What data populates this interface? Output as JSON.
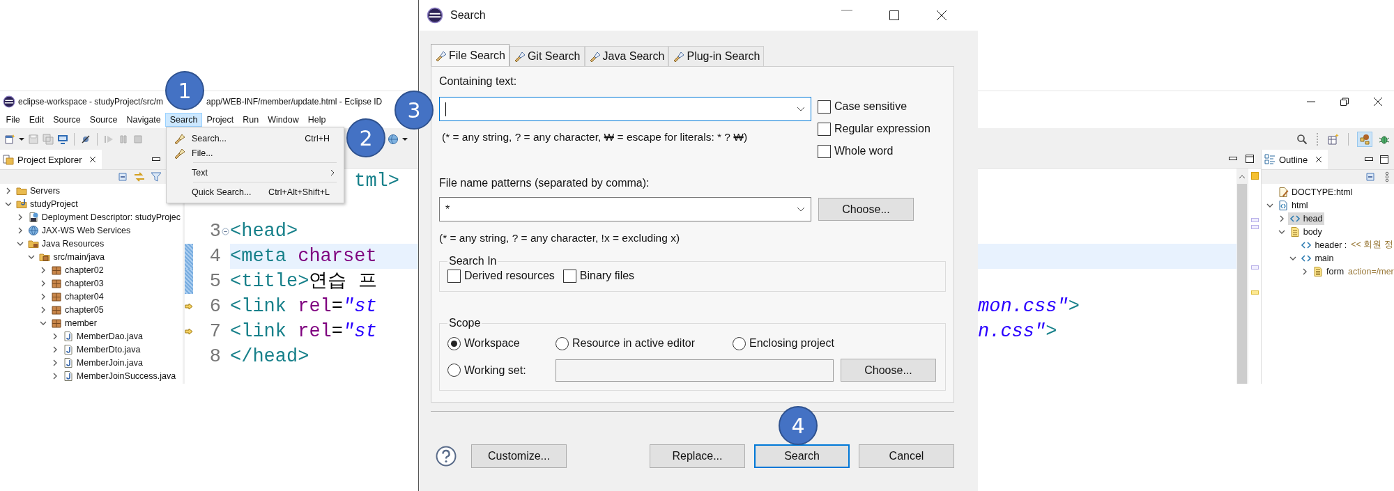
{
  "eclipse": {
    "title_start": "eclipse-workspace - studyProject/src/m",
    "title_end": "app/WEB-INF/member/update.html - Eclipse ID",
    "menu": [
      {
        "label": "File",
        "selected": false
      },
      {
        "label": "Edit",
        "selected": false
      },
      {
        "label": "Source",
        "selected": false
      },
      {
        "label": "Source",
        "selected": false
      },
      {
        "label": "Navigate",
        "selected": false
      },
      {
        "label": "Search",
        "selected": true
      },
      {
        "label": "Project",
        "selected": false
      },
      {
        "label": "Run",
        "selected": false
      },
      {
        "label": "Window",
        "selected": false
      },
      {
        "label": "Help",
        "selected": false
      }
    ],
    "menu_popup": [
      {
        "kind": "item",
        "label": "Search...",
        "shortcut": "Ctrl+H",
        "icon": true
      },
      {
        "kind": "item",
        "label": "File...",
        "icon": true
      },
      {
        "kind": "separator"
      },
      {
        "kind": "submenu",
        "label": "Text",
        "icon": false
      },
      {
        "kind": "separator"
      },
      {
        "kind": "item",
        "label": "Quick Search...",
        "shortcut": "Ctrl+Alt+Shift+L",
        "icon": false
      }
    ],
    "project_explorer": {
      "title": "Project Explorer",
      "tree": [
        {
          "label": "Servers",
          "kind": "folder",
          "expanded": false
        },
        {
          "label": "studyProject",
          "kind": "project",
          "expanded": true,
          "children": [
            {
              "label": "Deployment Descriptor: studyProjec",
              "kind": "descriptor",
              "expanded": false
            },
            {
              "label": "JAX-WS Web Services",
              "kind": "webservice",
              "expanded": false
            },
            {
              "label": "Java Resources",
              "kind": "resources",
              "expanded": true,
              "children": [
                {
                  "label": "src/main/java",
                  "kind": "srcfolder",
                  "expanded": true,
                  "children": [
                    {
                      "label": "chapter02",
                      "kind": "package",
                      "expanded": false
                    },
                    {
                      "label": "chapter03",
                      "kind": "package",
                      "expanded": false
                    },
                    {
                      "label": "chapter04",
                      "kind": "package",
                      "expanded": false
                    },
                    {
                      "label": "chapter05",
                      "kind": "package",
                      "expanded": false
                    },
                    {
                      "label": "member",
                      "kind": "package",
                      "expanded": true,
                      "children": [
                        {
                          "label": "MemberDao.java",
                          "kind": "java",
                          "expanded": false
                        },
                        {
                          "label": "MemberDto.java",
                          "kind": "java",
                          "expanded": false
                        },
                        {
                          "label": "MemberJoin.java",
                          "kind": "java",
                          "expanded": false
                        },
                        {
                          "label": "MemberJoinSuccess.java",
                          "kind": "java",
                          "expanded": false
                        }
                      ]
                    }
                  ]
                }
              ]
            }
          ]
        }
      ]
    },
    "editor": {
      "lines": [
        {
          "tokens": [
            {
              "kind": "tag",
              "text": "tml>"
            }
          ],
          "current": false
        },
        {
          "current": false
        },
        {
          "number": "3",
          "tokens": [
            {
              "kind": "tag",
              "text": "<head>"
            }
          ],
          "current": false,
          "fold": true,
          "changed": false,
          "flagged": false
        },
        {
          "number": "4",
          "tokens": [
            {
              "kind": "tag",
              "text": "<meta"
            },
            {
              "kind": "attr",
              "text": " charset"
            }
          ],
          "current": true,
          "fold": false,
          "changed": true,
          "flagged": false
        },
        {
          "number": "5",
          "tokens": [
            {
              "kind": "tag",
              "text": "<title>"
            },
            {
              "kind": "plain",
              "text": "연습 프"
            }
          ],
          "current": false,
          "fold": false,
          "changed": true,
          "flagged": false
        },
        {
          "number": "6",
          "tokens": [
            {
              "kind": "tag",
              "text": "<link"
            },
            {
              "kind": "attr",
              "text": " rel"
            },
            {
              "kind": "plain",
              "text": "="
            },
            {
              "kind": "string",
              "text": "\"st"
            }
          ],
          "tail": [
            {
              "kind": "string",
              "text": "mon.css\""
            },
            {
              "kind": "tag",
              "text": ">"
            }
          ],
          "current": false,
          "fold": false,
          "changed": false,
          "flagged": true
        },
        {
          "number": "7",
          "tokens": [
            {
              "kind": "tag",
              "text": "<link"
            },
            {
              "kind": "attr",
              "text": " rel"
            },
            {
              "kind": "plain",
              "text": "="
            },
            {
              "kind": "string",
              "text": "\"st"
            }
          ],
          "tail": [
            {
              "kind": "string",
              "text": "n.css\""
            },
            {
              "kind": "tag",
              "text": ">"
            }
          ],
          "current": false,
          "fold": false,
          "changed": false,
          "flagged": true
        },
        {
          "number": "8",
          "tokens": [
            {
              "kind": "tag",
              "text": "</head>"
            }
          ],
          "current": false,
          "fold": false,
          "changed": false,
          "flagged": false
        }
      ]
    },
    "outline": {
      "title": "Outline",
      "tree": [
        {
          "label": "DOCTYPE:html",
          "kind": "doctype",
          "selected": false
        },
        {
          "label": "html",
          "kind": "html",
          "expanded": true,
          "selected": false,
          "children": [
            {
              "label": "head",
              "kind": "element",
              "expanded": false,
              "selected": true
            },
            {
              "label": "body",
              "kind": "body",
              "expanded": true,
              "selected": false,
              "children": [
                {
                  "label": "header :",
                  "detail": "<< 회원 정",
                  "kind": "element",
                  "selected": false
                },
                {
                  "label": "main",
                  "kind": "element",
                  "expanded": true,
                  "selected": false,
                  "children": [
                    {
                      "label": "form",
                      "detail": "action=/mer",
                      "kind": "form",
                      "expanded": false,
                      "selected": false
                    }
                  ]
                }
              ]
            }
          ]
        }
      ]
    }
  },
  "dialog": {
    "title": "Search",
    "tabs": [
      {
        "label": "File Search",
        "selected": true
      },
      {
        "label": "Git Search",
        "selected": false
      },
      {
        "label": "Java Search",
        "selected": false
      },
      {
        "label": "Plug-in Search",
        "selected": false
      }
    ],
    "containing_label": "Containing text:",
    "containing_focused": true,
    "containing_hint": "(* = any string, ? = any character, ₩ = escape for literals: * ? ₩)",
    "options": [
      {
        "label": "Case sensitive",
        "checked": false
      },
      {
        "label": "Regular expression",
        "checked": false
      },
      {
        "label": "Whole word",
        "checked": false
      }
    ],
    "patterns_label": "File name patterns (separated by comma):",
    "patterns_value": "*",
    "patterns_button": "Choose...",
    "patterns_hint": "(* = any string, ? = any character, !x = excluding x)",
    "search_in": {
      "title": "Search In",
      "options": [
        {
          "label": "Derived resources",
          "checked": false
        },
        {
          "label": "Binary files",
          "checked": false
        }
      ]
    },
    "scope": {
      "title": "Scope",
      "options": [
        {
          "label": "Workspace",
          "selected": true
        },
        {
          "label": "Resource in active editor",
          "selected": false
        },
        {
          "label": "Enclosing project",
          "selected": false
        },
        {
          "label": "Working set:",
          "selected": false
        }
      ],
      "working_set_button": "Choose..."
    },
    "buttons": [
      {
        "label": "Customize...",
        "default": false
      },
      {
        "label": "Replace...",
        "default": false
      },
      {
        "label": "Search",
        "default": true
      },
      {
        "label": "Cancel",
        "default": false
      }
    ]
  },
  "badges": [
    "1",
    "2",
    "3",
    "4"
  ]
}
